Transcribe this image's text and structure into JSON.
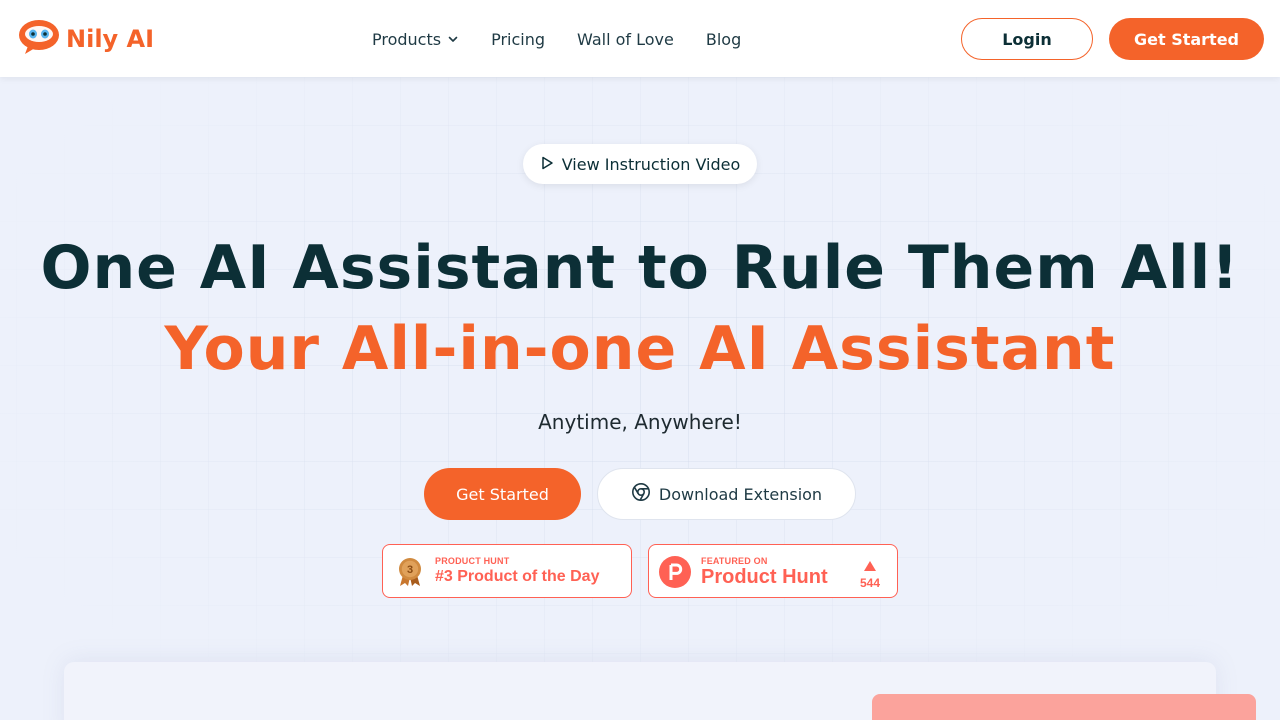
{
  "brand": {
    "name": "Nily AI",
    "accent": "#f4632a",
    "dark": "#0c2f36"
  },
  "nav": {
    "items": [
      {
        "label": "Products",
        "has_dropdown": true
      },
      {
        "label": "Pricing"
      },
      {
        "label": "Wall of Love"
      },
      {
        "label": "Blog"
      }
    ],
    "login_label": "Login",
    "get_started_label": "Get Started"
  },
  "hero": {
    "video_label": "View Instruction Video",
    "title_line1": "One AI Assistant to Rule Them All!",
    "title_line2": "Your All-in-one AI Assistant",
    "subtitle": "Anytime, Anywhere!",
    "cta_primary": "Get Started",
    "cta_secondary": "Download Extension",
    "badges": [
      {
        "kicker": "PRODUCT HUNT",
        "title": "#3 Product of the Day",
        "rank": "3"
      },
      {
        "kicker": "FEATURED ON",
        "title": "Product Hunt",
        "votes": "544"
      }
    ],
    "badge_color": "#ff6154"
  },
  "icons": [
    "logo-mascot-icon",
    "chevron-down-icon",
    "play-icon",
    "chrome-icon",
    "medal-icon",
    "product-hunt-icon",
    "upvote-icon"
  ]
}
